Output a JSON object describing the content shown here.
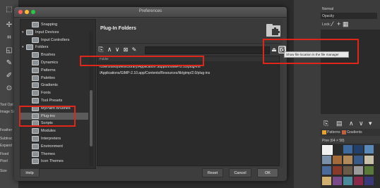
{
  "dialog": {
    "title": "Preferences",
    "header_title": "Plug-In Folders",
    "sidebar_items": [
      {
        "label": "Snapping",
        "level": 1,
        "expander": ""
      },
      {
        "label": "Input Devices",
        "level": 0,
        "expander": "▾"
      },
      {
        "label": "Input Controllers",
        "level": 1,
        "expander": ""
      },
      {
        "label": "Folders",
        "level": 0,
        "expander": "▾"
      },
      {
        "label": "Brushes",
        "level": 1,
        "expander": ""
      },
      {
        "label": "Dynamics",
        "level": 1,
        "expander": ""
      },
      {
        "label": "Patterns",
        "level": 1,
        "expander": ""
      },
      {
        "label": "Palettes",
        "level": 1,
        "expander": ""
      },
      {
        "label": "Gradients",
        "level": 1,
        "expander": ""
      },
      {
        "label": "Fonts",
        "level": 1,
        "expander": ""
      },
      {
        "label": "Tool Presets",
        "level": 1,
        "expander": ""
      },
      {
        "label": "MyPaint Brushes",
        "level": 1,
        "expander": ""
      },
      {
        "label": "Plug-ins",
        "level": 1,
        "expander": "",
        "selected": true
      },
      {
        "label": "Scripts",
        "level": 1,
        "expander": ""
      },
      {
        "label": "Modules",
        "level": 1,
        "expander": ""
      },
      {
        "label": "Interpreters",
        "level": 1,
        "expander": ""
      },
      {
        "label": "Environment",
        "level": 1,
        "expander": ""
      },
      {
        "label": "Themes",
        "level": 1,
        "expander": ""
      },
      {
        "label": "Icon Themes",
        "level": 1,
        "expander": ""
      }
    ],
    "column_header": "Folder",
    "folders": [
      "/Users/andybells/Library/Application Support/GIMP/2.10/plug-ins",
      "/Applications/GIMP-2.10.app/Contents/Resources/lib/gimp/2.0/plug-ins"
    ],
    "tooltip": "Show file location in the file manager",
    "buttons": {
      "help": "Help",
      "reset": "Reset",
      "cancel": "Cancel",
      "ok": "OK"
    },
    "toolbar_icons": [
      "new-folder-icon",
      "move-up-icon",
      "move-down-icon",
      "delete-icon",
      "writable-icon",
      "open-folder-icon",
      "show-location-icon"
    ]
  },
  "dock": {
    "mode_label": "Normal",
    "opacity_label": "Opacity",
    "lock_label": "Lock:",
    "tabs": [
      "Patterns",
      "Gradients"
    ],
    "pattern_name": "Pine (64 × 58)"
  },
  "toolbox": {
    "labels": [
      "Tool Opt",
      "Image Si",
      "Feather",
      "Subtrac",
      "Expand",
      "Fixed",
      "Pixel",
      "Size"
    ]
  },
  "colors": {
    "highlight": "#e0251b",
    "dialog_bg": "#3d3d3d",
    "list_bg": "#2b2b2b"
  }
}
